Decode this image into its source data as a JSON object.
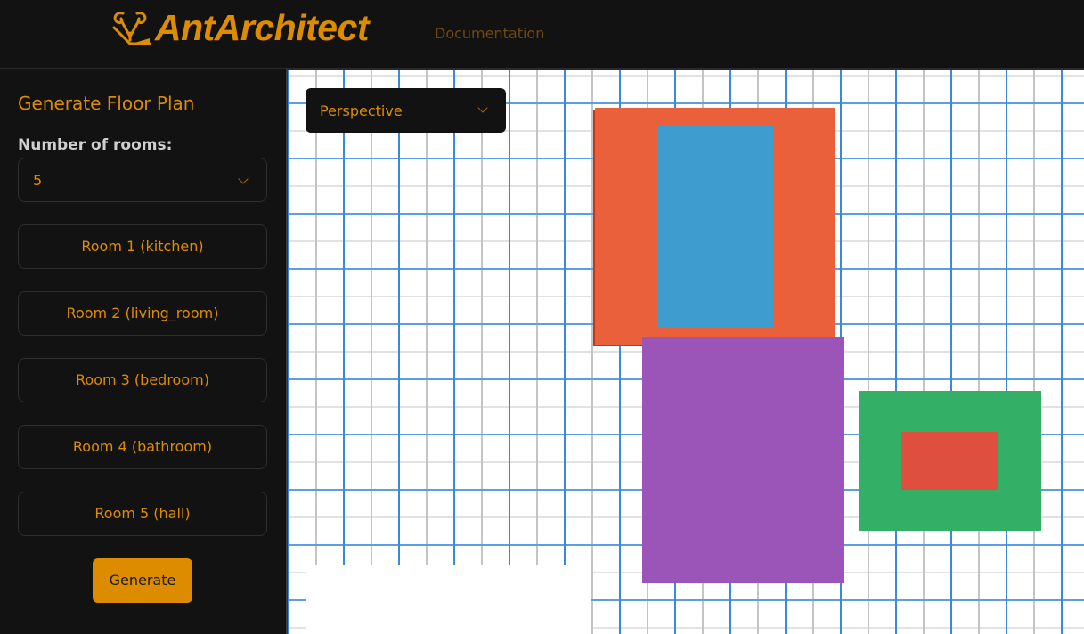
{
  "header": {
    "logo_icon": "ant-architect-logo-icon",
    "brand": "AntArchitect",
    "nav": [
      {
        "label": "Documentation"
      }
    ]
  },
  "sidebar": {
    "title": "Generate Floor Plan",
    "rooms_label": "Number of rooms:",
    "rooms_count": "5",
    "rooms": [
      {
        "label": "Room 1 (kitchen)"
      },
      {
        "label": "Room 2 (living_room)"
      },
      {
        "label": "Room 3 (bedroom)"
      },
      {
        "label": "Room 4 (bathroom)"
      },
      {
        "label": "Room 5 (hall)"
      }
    ],
    "generate_label": "Generate"
  },
  "canvas": {
    "view_mode": "Perspective",
    "rooms": [
      {
        "name": "kitchen",
        "color": "#ea603a"
      },
      {
        "name": "living_room",
        "color": "#3e9ccf"
      },
      {
        "name": "bedroom",
        "color": "#9b54b7"
      },
      {
        "name": "bathroom",
        "color": "#33b066"
      },
      {
        "name": "hall",
        "color": "#df4f40"
      }
    ]
  },
  "theme": {
    "accent": "#dd8c00",
    "background": "#121212",
    "grid_major": "#3b8ad9",
    "grid_minor": "#c4c4c4"
  }
}
